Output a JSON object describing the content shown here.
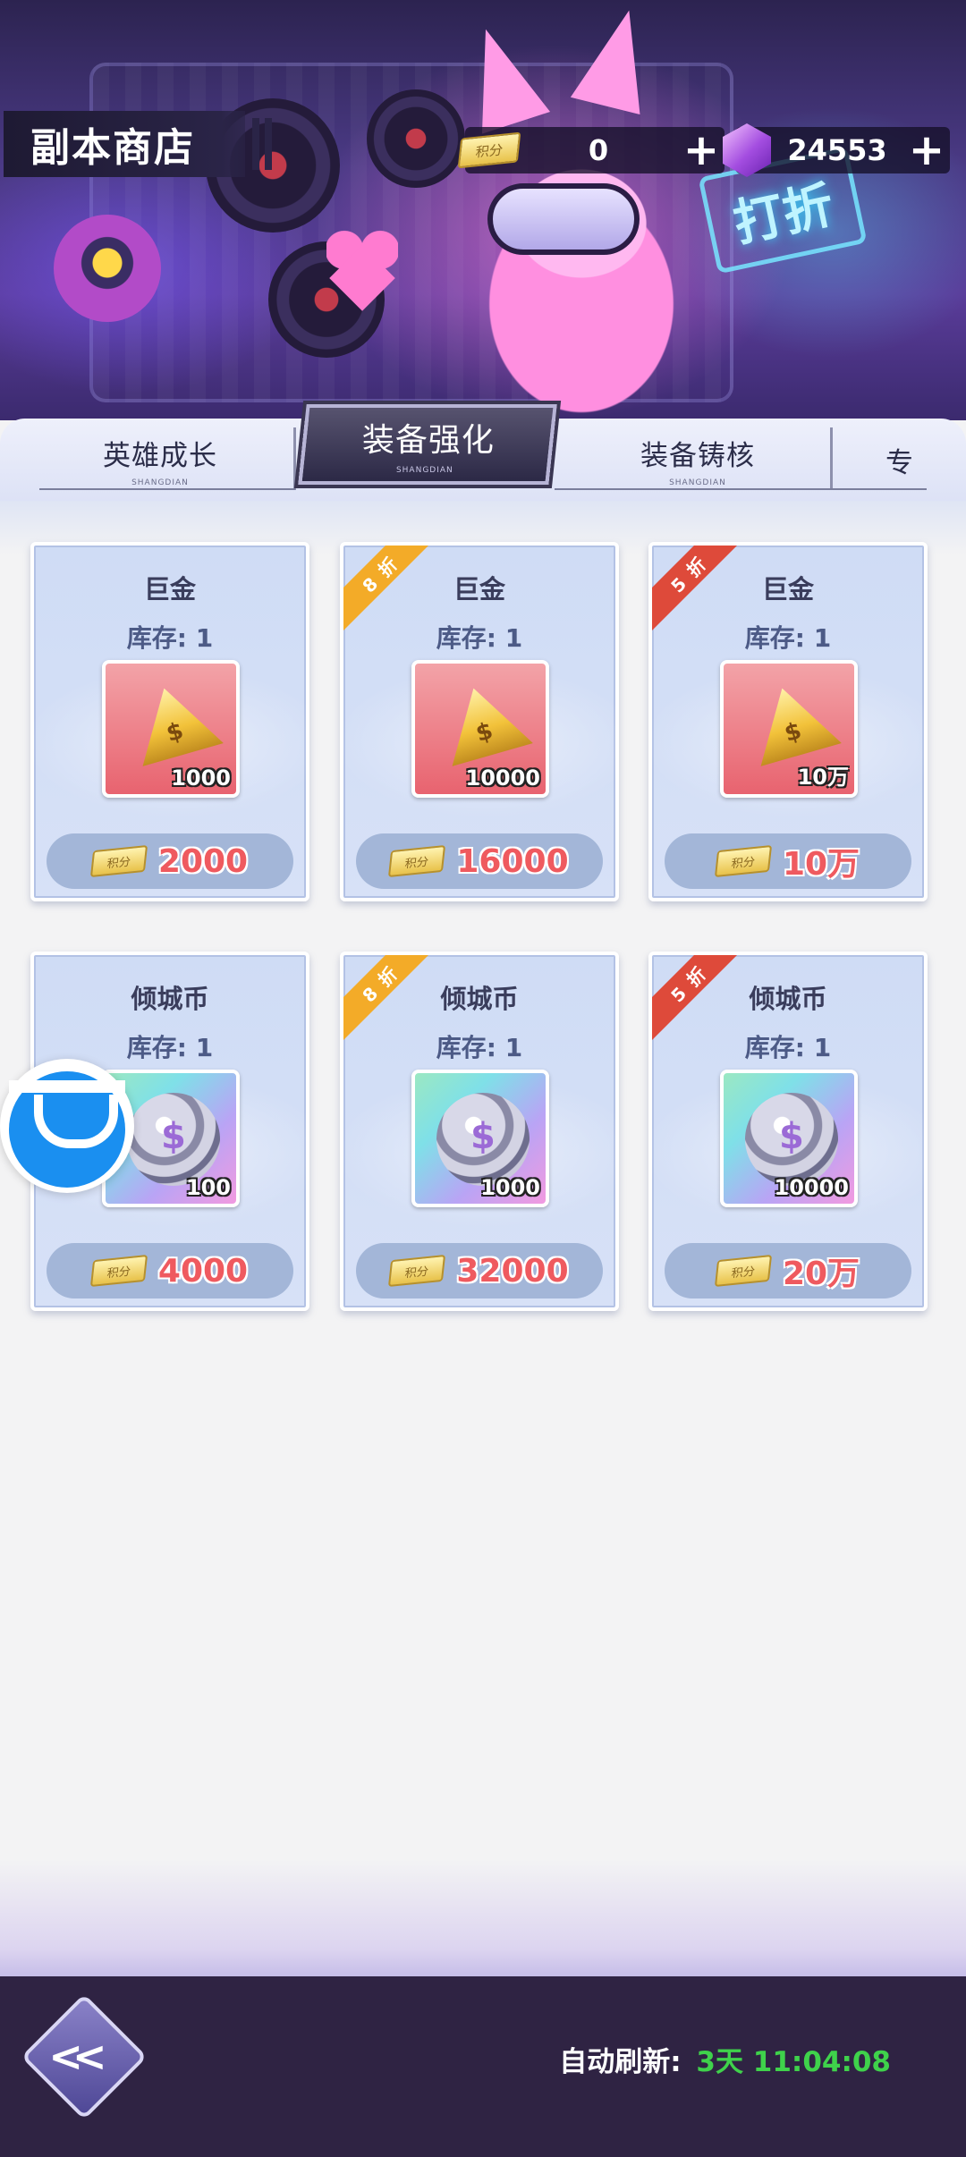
{
  "header": {
    "title": "副本商店",
    "points_label": "积分",
    "points_value": "0",
    "gems_value": "24553",
    "banner_sign": "打折"
  },
  "tabs": [
    {
      "label": "英雄成长",
      "sub": "SHANGDIAN",
      "active": false
    },
    {
      "label": "装备强化",
      "sub": "SHANGDIAN",
      "active": true
    },
    {
      "label": "装备铸核",
      "sub": "SHANGDIAN",
      "active": false
    },
    {
      "label": "专",
      "sub": "",
      "active": false
    }
  ],
  "items": [
    {
      "name": "巨金",
      "stock": "库存: 1",
      "qty": "1000",
      "price": "2000",
      "discount": "",
      "icon": "gold-triangle-icon"
    },
    {
      "name": "巨金",
      "stock": "库存: 1",
      "qty": "10000",
      "price": "16000",
      "discount": "8 折",
      "icon": "gold-triangle-icon"
    },
    {
      "name": "巨金",
      "stock": "库存: 1",
      "qty": "10万",
      "price": "10万",
      "discount": "5 折",
      "icon": "gold-triangle-icon"
    },
    {
      "name": "倾城币",
      "stock": "库存: 1",
      "qty": "100",
      "price": "4000",
      "discount": "",
      "icon": "silver-coin-icon"
    },
    {
      "name": "倾城币",
      "stock": "库存: 1",
      "qty": "1000",
      "price": "32000",
      "discount": "8 折",
      "icon": "silver-coin-icon"
    },
    {
      "name": "倾城币",
      "stock": "库存: 1",
      "qty": "10000",
      "price": "20万",
      "discount": "5 折",
      "icon": "silver-coin-icon"
    }
  ],
  "price_currency_label": "积分",
  "footer": {
    "refresh_label": "自动刷新:",
    "refresh_time": "3天 11:04:08"
  },
  "colors": {
    "price_red": "#ef5a5f",
    "timer_green": "#3fd24b",
    "discount_8": "#f3ab28",
    "discount_5": "#de4a3a",
    "footer_bg": "#2f2343"
  }
}
